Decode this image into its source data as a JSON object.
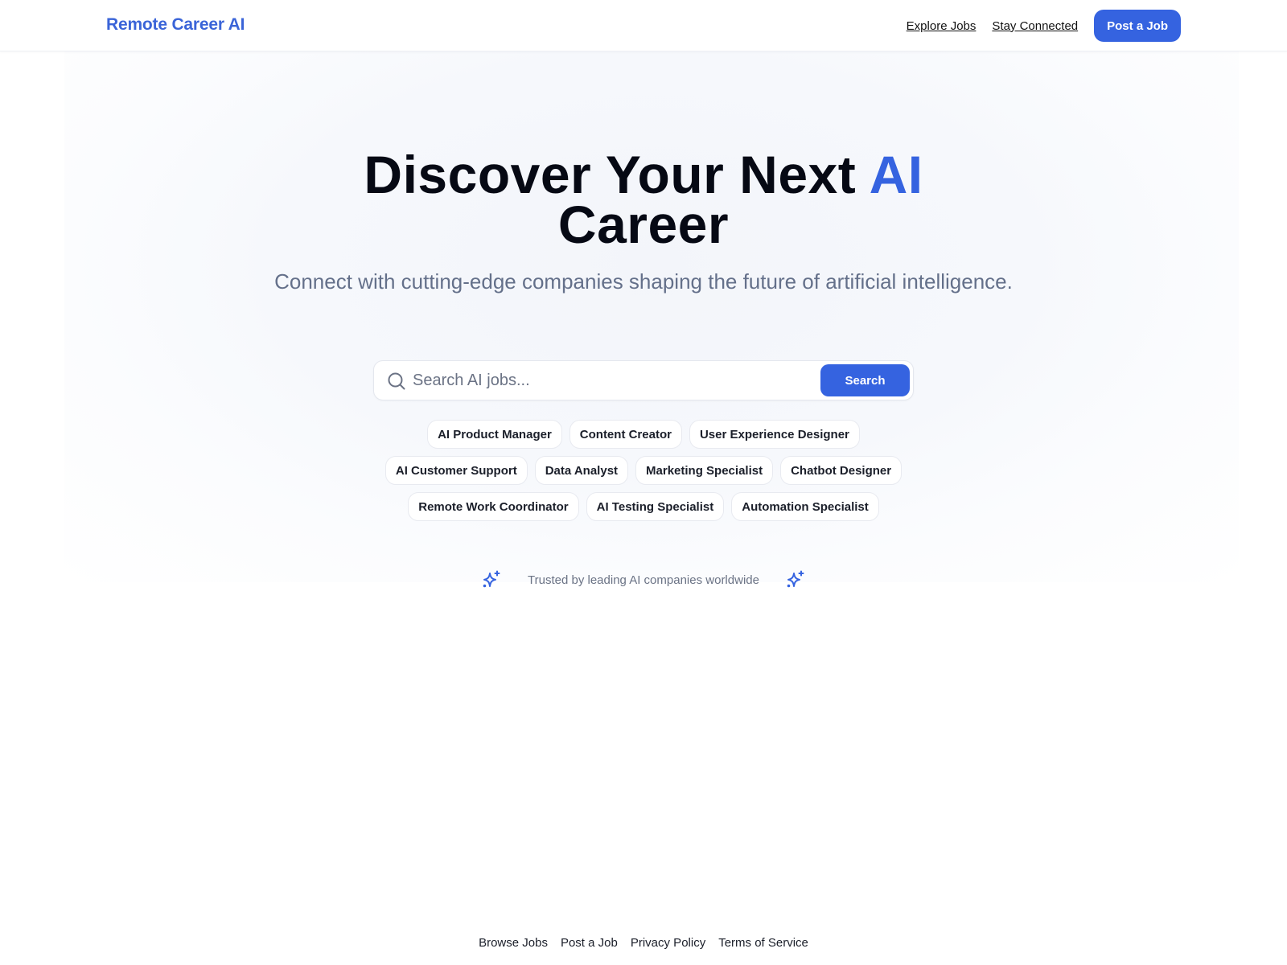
{
  "header": {
    "logo": "Remote Career AI",
    "nav": [
      {
        "label": "Explore Jobs"
      },
      {
        "label": "Stay Connected"
      }
    ],
    "cta_label": "Post a Job"
  },
  "hero": {
    "title_main": "Discover Your Next ",
    "title_accent": "AI",
    "title_line2": "Career",
    "subtitle": "Connect with cutting-edge companies shaping the future of artificial intelligence."
  },
  "search": {
    "icon": "search-icon",
    "placeholder": "Search AI jobs...",
    "value": "",
    "button_label": "Search"
  },
  "tags": [
    "AI Product Manager",
    "Content Creator",
    "User Experience Designer",
    "AI Customer Support",
    "Data Analyst",
    "Marketing Specialist",
    "Chatbot Designer",
    "Remote Work Coordinator",
    "AI Testing Specialist",
    "Automation Specialist"
  ],
  "trusted": {
    "icon": "sparkles-icon",
    "text": "Trusted by leading AI companies worldwide"
  },
  "footer": {
    "links": [
      "Browse Jobs",
      "Post a Job",
      "Privacy Policy",
      "Terms of Service"
    ]
  },
  "colors": {
    "accent": "#3563e0",
    "logo": "#3a64d8",
    "muted_text": "#64708a",
    "heading": "#060914"
  }
}
